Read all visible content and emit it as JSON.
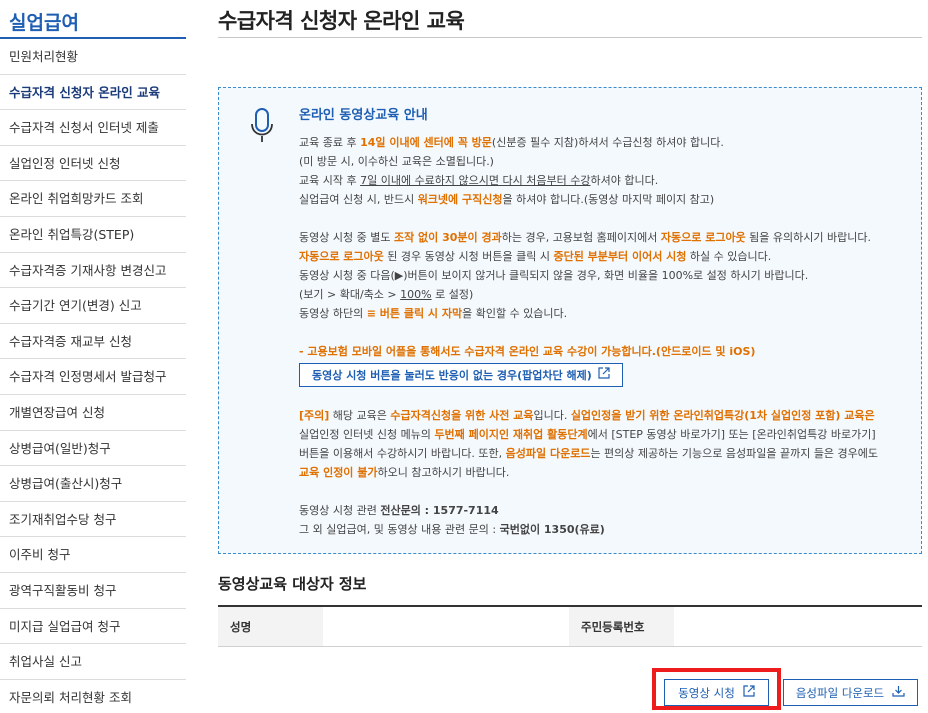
{
  "sidebar": {
    "title": "실업급여",
    "items": [
      "민원처리현황",
      "수급자격 신청자 온라인 교육",
      "수급자격 신청서 인터넷 제출",
      "실업인정 인터넷 신청",
      "온라인 취업희망카드 조회",
      "온라인 취업특강(STEP)",
      "수급자격증 기재사항 변경신고",
      "수급기간 연기(변경) 신고",
      "수급자격증 재교부 신청",
      "수급자격 인정명세서 발급청구",
      "개별연장급여 신청",
      "상병급여(일반)청구",
      "상병급여(출산시)청구",
      "조기재취업수당 청구",
      "이주비 청구",
      "광역구직활동비 청구",
      "미지급 실업급여 청구",
      "취업사실 신고",
      "자문의뢰 처리현황 조회"
    ]
  },
  "page": {
    "title": "수급자격 신청자 온라인 교육"
  },
  "notice": {
    "heading": "온라인 동영상교육 안내",
    "p1": {
      "a": "교육 종료 후 ",
      "b": "14일 이내에 센터에 꼭 방문",
      "c": "(신분증 필수 지참)하셔서 수급신청 하셔야 합니다."
    },
    "p2": "(미 방문 시, 이수하신 교육은 소멸됩니다.)",
    "p3": {
      "a": "교육 시작 후 ",
      "b": "7일 이내에 수료하지 않으시면 다시 처음부터 수강",
      "c": "하셔야 합니다."
    },
    "p4": {
      "a": "실업급여 신청 시, 반드시 ",
      "b": "워크넷에 구직신청",
      "c": "을 하셔야 합니다.(동영상 마지막 페이지 참고)"
    },
    "p5": {
      "a": "동영상 시청 중 별도 ",
      "b": "조작 없이 30분이 경과",
      "c": "하는 경우, 고용보험 홈페이지에서 ",
      "d": "자동으로 로그아웃",
      "e": " 됨을 유의하시기 바랍니다."
    },
    "p6": {
      "a": "자동으로 로그아웃",
      "b": " 된 경우 동영상 시청 버튼을 클릭 시 ",
      "c": "중단된 부분부터 이어서 시청",
      "d": " 하실 수 있습니다."
    },
    "p7": "동영상 시청 중 다음(▶)버튼이 보이지 않거나 클릭되지 않을 경우, 화면 비율을 100%로 설정 하시기 바랍니다.",
    "p8": {
      "a": "(보기 > 확대/축소 > ",
      "b": "100%",
      "c": " 로 설정)"
    },
    "p9": {
      "a": "동영상 하단의 ",
      "b": "≡ 버튼 클릭 시 자막",
      "c": "을 확인할 수 있습니다."
    },
    "mobile": "- 고용보험 모바일 어플을 통해서도 수급자격 온라인 교육 수강이 가능합니다.(안드로이드 및 iOS)",
    "popup_button": "동영상 시청 버튼을 눌러도 반응이 없는 경우(팝업차단 해제)",
    "caution": {
      "a": "[주의]",
      "b": " 해당 교육은 ",
      "c": "수급자격신청을 위한 사전 교육",
      "d": "입니다. ",
      "e": "실업인정을 받기 위한 온라인취업특강(1차 실업인정 포함) 교육",
      "f": "은"
    },
    "caution2": {
      "a": "실업인정 인터넷 신청 메뉴의 ",
      "b": "두번째 페이지인 재취업 활동단계",
      "c": "에서 [STEP 동영상 바로가기] 또는 [온라인취업특강 바로가기]"
    },
    "caution3": {
      "a": "버튼을 이용해서 수강하시기 바랍니다. 또한, ",
      "b": "음성파일 다운로드",
      "c": "는 편의상 제공하는 기능으로 음성파일을 끝까지 들은 경우에도"
    },
    "caution4": {
      "a": "교육 인정이 불가",
      "b": "하오니 참고하시기 바랍니다."
    },
    "contact1": {
      "a": "동영상 시청 관련 ",
      "b": "전산문의 : 1577-7114"
    },
    "contact2": {
      "a": "그 외 실업급여, 및 동영상 내용 관련 문의 : ",
      "b": "국번없이 1350(유료)"
    }
  },
  "info": {
    "title": "동영상교육 대상자 정보",
    "name_label": "성명",
    "name_value": "",
    "rrn_label": "주민등록번호",
    "rrn_value": ""
  },
  "buttons": {
    "watch": "동영상 시청",
    "download": "음성파일 다운로드"
  },
  "colors": {
    "accent": "#1e5fb3",
    "highlight": "#e07000",
    "annotation_box": "#ee1c1c"
  }
}
